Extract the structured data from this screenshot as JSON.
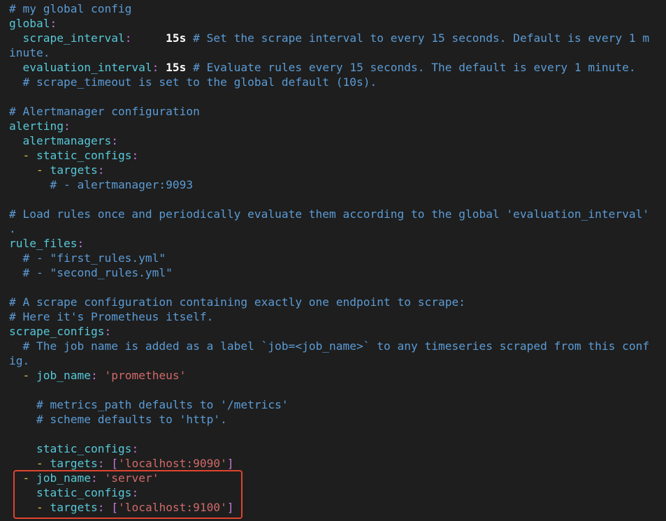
{
  "editor": {
    "lines": [
      [
        {
          "t": "# my global config",
          "c": "c"
        }
      ],
      [
        {
          "t": "global",
          "c": "k"
        },
        {
          "t": ":",
          "c": "p"
        }
      ],
      [
        {
          "t": "  "
        },
        {
          "t": "scrape_interval",
          "c": "k"
        },
        {
          "t": ":",
          "c": "p"
        },
        {
          "t": "     "
        },
        {
          "t": "15s",
          "c": "v"
        },
        {
          "t": " # Set the scrape interval to every 15 seconds. Default is every 1 m",
          "c": "c"
        }
      ],
      [
        {
          "t": "inute.",
          "c": "c"
        }
      ],
      [
        {
          "t": "  "
        },
        {
          "t": "evaluation_interval",
          "c": "k"
        },
        {
          "t": ":",
          "c": "p"
        },
        {
          "t": " "
        },
        {
          "t": "15s",
          "c": "v"
        },
        {
          "t": " # Evaluate rules every 15 seconds. The default is every 1 minute.",
          "c": "c"
        }
      ],
      [
        {
          "t": "  "
        },
        {
          "t": "# scrape_timeout is set to the global default (10s).",
          "c": "c"
        }
      ],
      [],
      [
        {
          "t": "# Alertmanager configuration",
          "c": "c"
        }
      ],
      [
        {
          "t": "alerting",
          "c": "k"
        },
        {
          "t": ":",
          "c": "p"
        }
      ],
      [
        {
          "t": "  "
        },
        {
          "t": "alertmanagers",
          "c": "k"
        },
        {
          "t": ":",
          "c": "p"
        }
      ],
      [
        {
          "t": "  "
        },
        {
          "t": "-",
          "c": "d"
        },
        {
          "t": " "
        },
        {
          "t": "static_configs",
          "c": "k"
        },
        {
          "t": ":",
          "c": "p"
        }
      ],
      [
        {
          "t": "    "
        },
        {
          "t": "-",
          "c": "d"
        },
        {
          "t": " "
        },
        {
          "t": "targets",
          "c": "k"
        },
        {
          "t": ":",
          "c": "p"
        }
      ],
      [
        {
          "t": "      "
        },
        {
          "t": "# - alertmanager:9093",
          "c": "c"
        }
      ],
      [],
      [
        {
          "t": "# Load rules once and periodically evaluate them according to the global 'evaluation_interval'",
          "c": "c"
        }
      ],
      [
        {
          "t": ".",
          "c": "c"
        }
      ],
      [
        {
          "t": "rule_files",
          "c": "k"
        },
        {
          "t": ":",
          "c": "p"
        }
      ],
      [
        {
          "t": "  "
        },
        {
          "t": "# - \"first_rules.yml\"",
          "c": "c"
        }
      ],
      [
        {
          "t": "  "
        },
        {
          "t": "# - \"second_rules.yml\"",
          "c": "c"
        }
      ],
      [],
      [
        {
          "t": "# A scrape configuration containing exactly one endpoint to scrape:",
          "c": "c"
        }
      ],
      [
        {
          "t": "# Here it's Prometheus itself.",
          "c": "c"
        }
      ],
      [
        {
          "t": "scrape_configs",
          "c": "k"
        },
        {
          "t": ":",
          "c": "p"
        }
      ],
      [
        {
          "t": "  "
        },
        {
          "t": "# The job name is added as a label `job=<job_name>` to any timeseries scraped from this conf",
          "c": "c"
        }
      ],
      [
        {
          "t": "ig.",
          "c": "c"
        }
      ],
      [
        {
          "t": "  "
        },
        {
          "t": "-",
          "c": "d"
        },
        {
          "t": " "
        },
        {
          "t": "job_name",
          "c": "k"
        },
        {
          "t": ":",
          "c": "p"
        },
        {
          "t": " "
        },
        {
          "t": "'prometheus'",
          "c": "s"
        }
      ],
      [],
      [
        {
          "t": "    "
        },
        {
          "t": "# metrics_path defaults to '/metrics'",
          "c": "c"
        }
      ],
      [
        {
          "t": "    "
        },
        {
          "t": "# scheme defaults to 'http'.",
          "c": "c"
        }
      ],
      [],
      [
        {
          "t": "    "
        },
        {
          "t": "static_configs",
          "c": "k"
        },
        {
          "t": ":",
          "c": "p"
        }
      ],
      [
        {
          "t": "    "
        },
        {
          "t": "-",
          "c": "d"
        },
        {
          "t": " "
        },
        {
          "t": "targets",
          "c": "k"
        },
        {
          "t": ":",
          "c": "p"
        },
        {
          "t": " "
        },
        {
          "t": "[",
          "c": "p"
        },
        {
          "t": "'localhost:9090'",
          "c": "s"
        },
        {
          "t": "]",
          "c": "p"
        }
      ],
      [
        {
          "t": "  "
        },
        {
          "t": "-",
          "c": "d"
        },
        {
          "t": " "
        },
        {
          "t": "job_name",
          "c": "k"
        },
        {
          "t": ":",
          "c": "p"
        },
        {
          "t": " "
        },
        {
          "t": "'server'",
          "c": "s"
        }
      ],
      [
        {
          "t": "    "
        },
        {
          "t": "static_configs",
          "c": "k"
        },
        {
          "t": ":",
          "c": "p"
        }
      ],
      [
        {
          "t": "    "
        },
        {
          "t": "-",
          "c": "d"
        },
        {
          "t": " "
        },
        {
          "t": "targets",
          "c": "k"
        },
        {
          "t": ":",
          "c": "p"
        },
        {
          "t": " "
        },
        {
          "t": "[",
          "c": "p"
        },
        {
          "t": "'localhost:9100'",
          "c": "s"
        },
        {
          "t": "]",
          "c": "p"
        }
      ]
    ]
  },
  "colors": {
    "background": "#1e1e1e",
    "comment": "#5b9bd5",
    "key": "#57c8d8",
    "punctuation": "#c678dd",
    "string": "#d16969",
    "value": "#ffffff",
    "dash": "#e0c04c",
    "highlight_box": "#e0442f"
  }
}
